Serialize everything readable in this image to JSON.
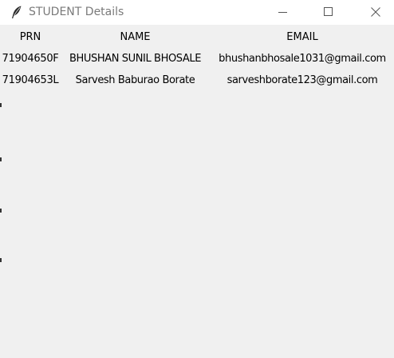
{
  "window": {
    "title": "STUDENT Details"
  },
  "table": {
    "headers": [
      "PRN",
      "NAME",
      "EMAIL"
    ],
    "rows": [
      [
        "71904650F",
        "BHUSHAN SUNIL BHOSALE",
        "bhushanbhosale1031@gmail.com"
      ],
      [
        "71904653L",
        "Sarvesh Baburao Borate",
        "sarveshborate123@gmail.com"
      ]
    ]
  },
  "icons": {
    "app": "feather-icon",
    "minimize": "minimize-icon",
    "maximize": "maximize-icon",
    "close": "close-icon"
  }
}
